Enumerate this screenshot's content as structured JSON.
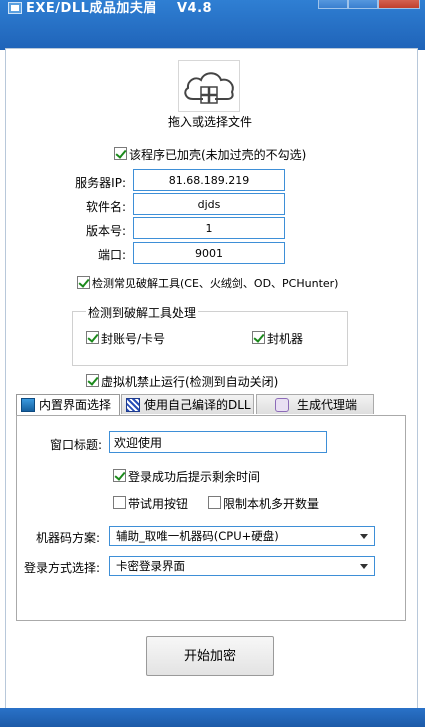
{
  "window": {
    "title": "EXE/DLL成品加夫眉    V4.8"
  },
  "drop": {
    "hint": "拖入或选择文件"
  },
  "packed_checkbox": {
    "label": "该程序已加壳(未加过壳的不勾选)",
    "checked": true
  },
  "form": {
    "server_ip_label": "服务器IP:",
    "server_ip_value": "81.68.189.219",
    "software_name_label": "软件名:",
    "software_name_value": "djds",
    "version_label": "版本号:",
    "version_value": "1",
    "port_label": "端口:",
    "port_value": "9001"
  },
  "detect_tools": {
    "label": "检测常见破解工具(CE、火绒剑、OD、PCHunter)",
    "checked": true
  },
  "crack_group": {
    "title": "检测到破解工具处理",
    "ban_account_label": "封账号/卡号",
    "ban_account_checked": true,
    "ban_machine_label": "封机器",
    "ban_machine_checked": true
  },
  "vm_block": {
    "label": "虚拟机禁止运行(检测到自动关闭)",
    "checked": true
  },
  "tabs": [
    {
      "label": "内置界面选择",
      "icon": "builtin-ui-icon",
      "active": true
    },
    {
      "label": "使用自己编译的DLL",
      "icon": "dll-icon",
      "active": false
    },
    {
      "label": "生成代理端",
      "icon": "proxy-icon",
      "active": false
    }
  ],
  "panel": {
    "window_title_label": "窗口标题:",
    "window_title_value": "欢迎使用",
    "show_remaining_label": "登录成功后提示剩余时间",
    "show_remaining_checked": true,
    "trial_button_label": "带试用按钮",
    "trial_button_checked": false,
    "limit_multi_label": "限制本机多开数量",
    "limit_multi_checked": false,
    "machine_code_label": "机器码方案:",
    "machine_code_value": "辅助_取唯一机器码(CPU+硬盘)",
    "login_mode_label": "登录方式选择:",
    "login_mode_value": "卡密登录界面"
  },
  "actions": {
    "start_label": "开始加密"
  },
  "colors": {
    "titlebar": "#2374c6",
    "field_border": "#3e8fd7",
    "check": "#1c8a1c"
  }
}
